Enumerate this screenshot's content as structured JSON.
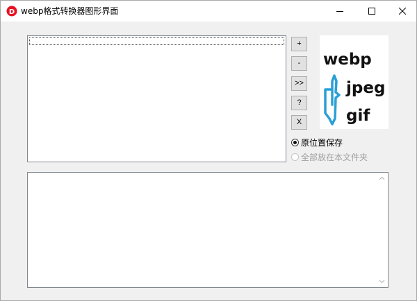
{
  "window": {
    "title": "webp格式转换器图形界面",
    "app_icon": "app-logo-icon",
    "controls": [
      "minimize-icon",
      "maximize-icon",
      "close-icon"
    ]
  },
  "side_buttons": {
    "add": "+",
    "remove": "-",
    "convert": ">>",
    "help": "?",
    "clear": "X"
  },
  "logo": {
    "text_webp": "webp",
    "text_jpeg": "jpeg",
    "text_gif": "gif",
    "arrow_color": "#2a9fd6"
  },
  "options": {
    "save_in_place": "原位置保存",
    "save_to_folder": "全部放在本文件夹",
    "selected": "save_in_place"
  },
  "colors": {
    "accent_red": "#e81123",
    "window_bg": "#f0f0f0"
  }
}
